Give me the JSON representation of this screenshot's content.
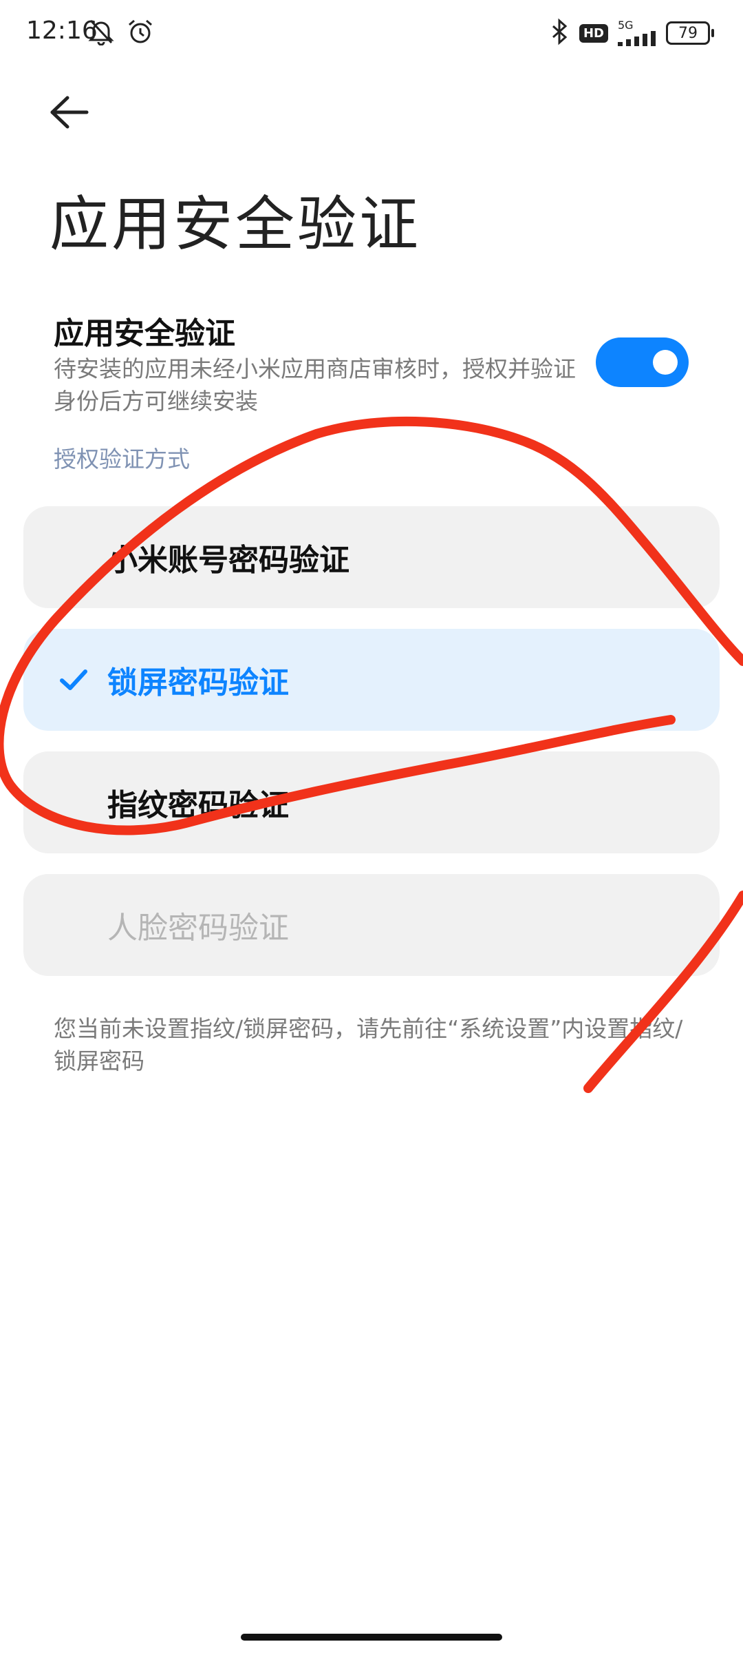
{
  "status_bar": {
    "time": "12:16",
    "battery": "79",
    "network": "5G",
    "hd": "HD",
    "icons": [
      "bell-off-icon",
      "alarm-icon",
      "bluetooth-icon",
      "hd-icon",
      "signal-icon",
      "battery-icon"
    ]
  },
  "header": {
    "back_icon": "arrow-left-icon",
    "title": "应用安全验证"
  },
  "setting": {
    "title": "应用安全验证",
    "description": "待安装的应用未经小米应用商店审核时，授权并验证身份后方可继续安装",
    "enabled": true
  },
  "auth": {
    "section_label": "授权验证方式",
    "options": [
      {
        "label": "小米账号密码验证",
        "state": "normal"
      },
      {
        "label": "锁屏密码验证",
        "state": "selected"
      },
      {
        "label": "指纹密码验证",
        "state": "normal"
      },
      {
        "label": "人脸密码验证",
        "state": "disabled"
      }
    ]
  },
  "note": "您当前未设置指纹/锁屏密码，请先前往“系统设置”内设置指纹/锁屏密码",
  "colors": {
    "accent": "#0d84ff",
    "selected_bg": "#e4f1fd",
    "option_bg": "#f1f1f1",
    "annotation": "#f1321a"
  }
}
